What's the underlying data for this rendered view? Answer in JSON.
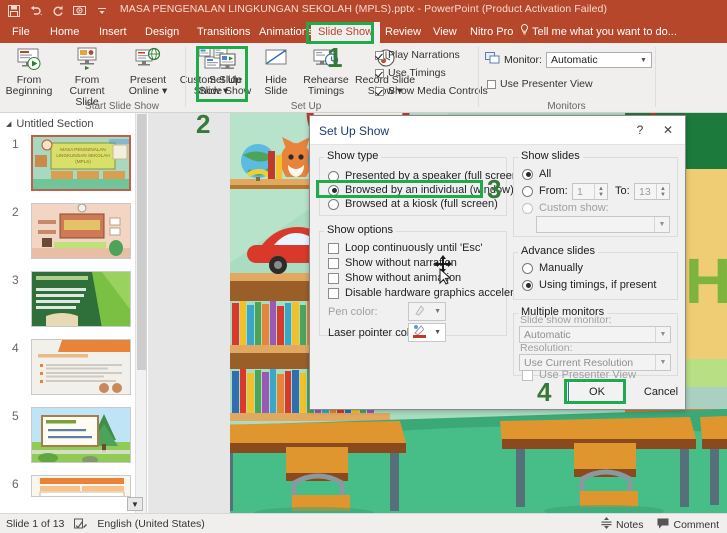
{
  "titlebar": {
    "document_title": "MASA PENGENALAN LINGKUNGAN SEKOLAH (MPLS).pptx  -  PowerPoint (Product Activation Failed)",
    "qat": [
      {
        "name": "save-icon",
        "label": "Save"
      },
      {
        "name": "undo-icon",
        "label": "Undo"
      },
      {
        "name": "redo-icon",
        "label": "Redo"
      },
      {
        "name": "start-from-beginning-icon",
        "label": "Start From Beginning"
      },
      {
        "name": "customize-qat-icon",
        "label": "Customize Quick Access Toolbar"
      }
    ]
  },
  "tabs": [
    {
      "label": "File",
      "active": false
    },
    {
      "label": "Home",
      "active": false
    },
    {
      "label": "Insert",
      "active": false
    },
    {
      "label": "Design",
      "active": false
    },
    {
      "label": "Transitions",
      "active": false
    },
    {
      "label": "Animations",
      "active": false
    },
    {
      "label": "Slide Show",
      "active": true
    },
    {
      "label": "Review",
      "active": false
    },
    {
      "label": "View",
      "active": false
    },
    {
      "label": "Nitro Pro",
      "active": false
    }
  ],
  "tellme": "Tell me what you want to do...",
  "ribbon": {
    "groups": [
      {
        "label": "Start Slide Show"
      },
      {
        "label": "Set Up"
      },
      {
        "label": "Monitors"
      }
    ],
    "buttons": [
      {
        "name": "from-beginning-button",
        "line1": "From",
        "line2": "Beginning"
      },
      {
        "name": "from-current-slide-button",
        "line1": "From",
        "line2": "Current Slide"
      },
      {
        "name": "present-online-button",
        "line1": "Present",
        "line2": "Online ▾"
      },
      {
        "name": "custom-slide-show-button",
        "line1": "Custom Slide",
        "line2": "Show ▾"
      },
      {
        "name": "set-up-slide-show-button",
        "line1": "Set Up",
        "line2": "Slide Show"
      },
      {
        "name": "hide-slide-button",
        "line1": "Hide",
        "line2": "Slide"
      },
      {
        "name": "rehearse-timings-button",
        "line1": "Rehearse",
        "line2": "Timings"
      },
      {
        "name": "record-slide-show-button",
        "line1": "Record Slide",
        "line2": "Show ▾"
      }
    ],
    "checkboxes": [
      {
        "name": "play-narrations-checkbox",
        "label": "Play Narrations",
        "checked": true
      },
      {
        "name": "use-timings-checkbox",
        "label": "Use Timings",
        "checked": true
      },
      {
        "name": "show-media-controls-checkbox",
        "label": "Show Media Controls",
        "checked": true
      }
    ],
    "monitors": {
      "monitor_label": "Monitor:",
      "monitor_value": "Automatic",
      "presenter_view_label": "Use Presenter View",
      "presenter_view_checked": false
    }
  },
  "left_pane": {
    "section_label": "Untitled Section",
    "slides": [
      {
        "number": "1",
        "selected": true
      },
      {
        "number": "2",
        "selected": false
      },
      {
        "number": "3",
        "selected": false
      },
      {
        "number": "4",
        "selected": false
      },
      {
        "number": "5",
        "selected": false
      },
      {
        "number": "6",
        "selected": false
      }
    ],
    "slide1_title_line1": "MASA PENGENALAN",
    "slide1_title_line2": "LINGKUNGAN SEKOLAH",
    "slide1_title_line3": "(MPLS)"
  },
  "dialog": {
    "title": "Set Up Show",
    "help_icon": "?",
    "close_icon": "✕",
    "show_type": {
      "title": "Show type",
      "options": [
        {
          "label": "Presented by a speaker (full screen)",
          "selected": false
        },
        {
          "label": "Browsed by an individual (window)",
          "selected": true
        },
        {
          "label": "Browsed at a kiosk (full screen)",
          "selected": false
        }
      ]
    },
    "show_options": {
      "title": "Show options",
      "checkboxes": [
        {
          "label": "Loop continuously until 'Esc'",
          "checked": false
        },
        {
          "label": "Show without narration",
          "checked": false
        },
        {
          "label": "Show without animation",
          "checked": false
        },
        {
          "label": "Disable hardware graphics acceleration",
          "checked": false
        }
      ],
      "pen_color_label": "Pen color:",
      "laser_color_label": "Laser pointer color:"
    },
    "show_slides": {
      "title": "Show slides",
      "all_label": "All",
      "all_selected": true,
      "from_label": "From:",
      "from_value": "1",
      "to_label": "To:",
      "to_value": "13",
      "from_selected": false,
      "custom_label": "Custom show:",
      "custom_selected": false,
      "custom_value": ""
    },
    "advance_slides": {
      "title": "Advance slides",
      "options": [
        {
          "label": "Manually",
          "selected": false
        },
        {
          "label": "Using timings, if present",
          "selected": true
        }
      ]
    },
    "multiple_monitors": {
      "title": "Multiple monitors",
      "monitor_label": "Slide show monitor:",
      "monitor_value": "Automatic",
      "resolution_label": "Resolution:",
      "resolution_value": "Use Current Resolution",
      "presenter_label": "Use Presenter View",
      "presenter_checked": false
    },
    "ok_label": "OK",
    "cancel_label": "Cancel"
  },
  "annotations": {
    "accent_color": "#1faa4b",
    "number_color": "#357a38",
    "steps": [
      {
        "number": "1",
        "target": "slide-show-tab"
      },
      {
        "number": "2",
        "target": "set-up-slide-show-button"
      },
      {
        "number": "3",
        "target": "browsed-by-individual-radio"
      },
      {
        "number": "4",
        "target": "ok-button"
      }
    ]
  },
  "statusbar": {
    "slide_counter": "Slide 1 of 13",
    "language": "English (United States)",
    "spellcheck_icon": "spellcheck-icon",
    "notes_label": "Notes",
    "comments_label": "Comment"
  }
}
